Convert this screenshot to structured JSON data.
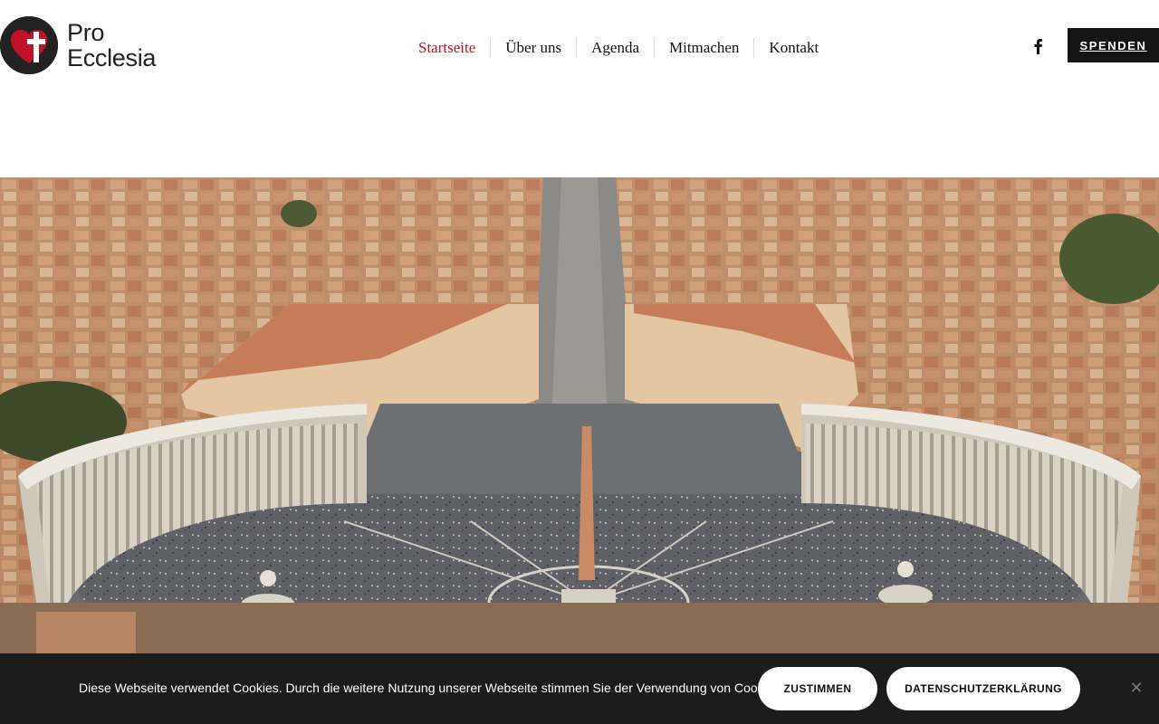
{
  "header": {
    "logo": {
      "line1": "Pro",
      "line2": "Ecclesia",
      "icon": "heart-cross-logo",
      "colors": {
        "circle": "#222222",
        "heart": "#c0102a",
        "cross": "#ffffff"
      }
    },
    "nav": [
      {
        "label": "Startseite",
        "active": true
      },
      {
        "label": "Über uns",
        "active": false
      },
      {
        "label": "Agenda",
        "active": false
      },
      {
        "label": "Mitmachen",
        "active": false
      },
      {
        "label": "Kontakt",
        "active": false
      }
    ],
    "social_icon": "facebook-icon",
    "donate_label": "SPENDEN"
  },
  "hero": {
    "image": "aerial-view-st-peters-square"
  },
  "cookie_banner": {
    "text": "Diese Webseite verwendet Cookies. Durch die weitere Nutzung unserer Webseite stimmen Sie der Verwendung von Cookies zu.",
    "accept_label": "ZUSTIMMEN",
    "privacy_label": "DATENSCHUTZERKLÄRUNG",
    "close_icon": "close-icon"
  },
  "colors": {
    "accent": "#c0102a",
    "dark": "#151515",
    "cookie_bg": "#1c1c1c"
  }
}
